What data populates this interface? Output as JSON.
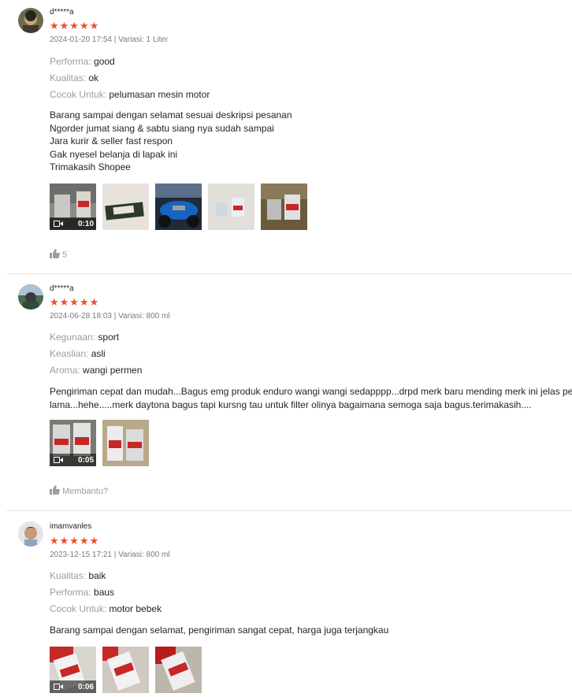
{
  "colors": {
    "star": "#ee4d2d",
    "muted": "#9e9e9e",
    "divider": "#e8e8e8"
  },
  "reviews": [
    {
      "username": "d*****a",
      "stars": "★★★★★",
      "date": "2024-01-20 17:54",
      "sep": " | ",
      "variant": "Variasi: 1 Liter",
      "attrs": [
        {
          "key": "Performa:",
          "value": "good"
        },
        {
          "key": "Kualitas:",
          "value": "ok"
        },
        {
          "key": "Cocok Untuk:",
          "value": "pelumasan mesin motor"
        }
      ],
      "body": [
        "Barang sampai dengan selamat sesuai deskripsi pesanan",
        "Ngorder jumat siang & sabtu siang nya sudah sampai",
        "Jara kurir & seller fast respon",
        "Gak nyesel belanja di lapak ini",
        "Trimakasih Shopee"
      ],
      "video_duration": "0:10",
      "like_count": "5"
    },
    {
      "username": "d*****a",
      "stars": "★★★★★",
      "date": "2024-06-28 18:03",
      "sep": " | ",
      "variant": "Variasi: 800 ml",
      "attrs": [
        {
          "key": "Kegunaan:",
          "value": "sport"
        },
        {
          "key": "Keaslian:",
          "value": "asli"
        },
        {
          "key": "Aroma:",
          "value": "wangi permen"
        }
      ],
      "body": [
        "Pengiriman cepat dan mudah...Bagus emg produk enduro wangi wangi sedapppp...drpd merk baru mending merk ini jelas pemain",
        "lama...hehe.....merk daytona bagus tapi kursng tau untuk filter olinya bagaimana  semoga saja bagus.terimakasih...."
      ],
      "video_duration": "0:05",
      "like_label": "Membantu?"
    },
    {
      "username": "imamvanles",
      "stars": "★★★★★",
      "date": "2023-12-15 17:21",
      "sep": " | ",
      "variant": "Variasi: 800 ml",
      "attrs": [
        {
          "key": "Kualitas:",
          "value": "baik"
        },
        {
          "key": "Performa:",
          "value": "baus"
        },
        {
          "key": "Cocok Untuk:",
          "value": "motor bebek"
        }
      ],
      "body": [
        "Barang sampai dengan selamat, pengiriman sangat cepat, harga juga terjangkau"
      ],
      "video_duration": "0:06"
    }
  ]
}
